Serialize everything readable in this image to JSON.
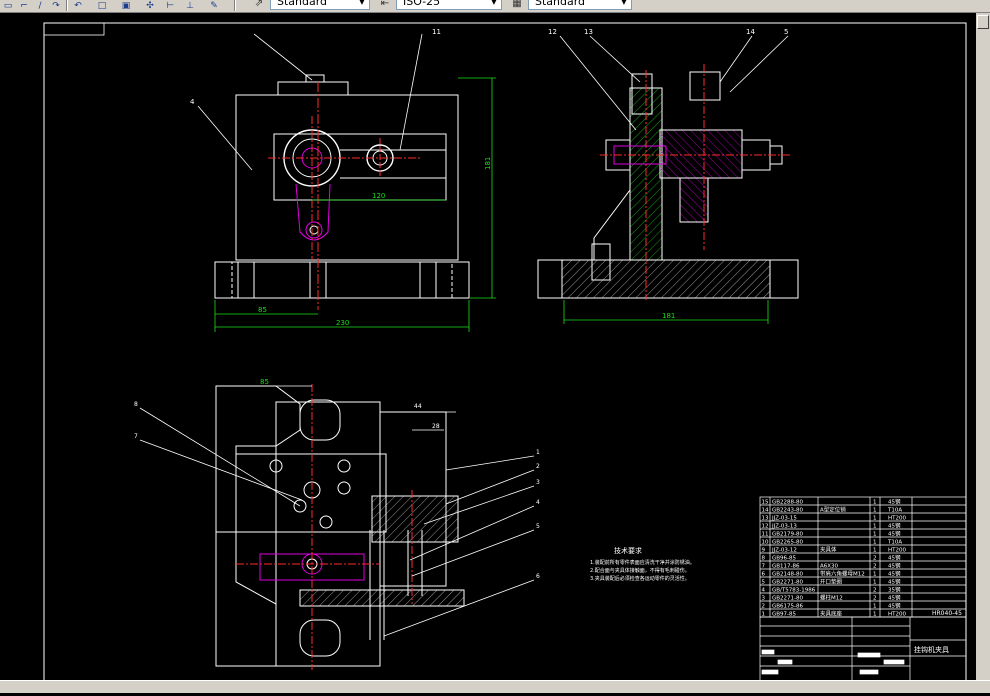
{
  "toolbar": {
    "text_style_value": "Standard",
    "dim_style_value": "ISO-25",
    "table_style_value": "Standard"
  },
  "drawing": {
    "balloons_top_view": [
      "11",
      "4"
    ],
    "balloons_side_view": [
      "12",
      "13",
      "14",
      "5"
    ],
    "balloons_plan_view": [
      "8",
      "7",
      "1",
      "2",
      "3",
      "4",
      "5",
      "6"
    ],
    "dim_top_width": "230",
    "dim_top_offset": "85",
    "dim_top_hole": "120",
    "dim_top_height": "181",
    "dim_side_width": "181",
    "dim_plan_85": "85",
    "dim_plan_a": "44",
    "dim_plan_b": "28",
    "tech_title": "技术要求",
    "tech_line_1": "1.装配前所有零件表面应清洗干净并涂防锈油。",
    "tech_line_2": "2.配合面与夹具体接触面，不得有毛刺碰伤。",
    "tech_line_3": "3.夹具装配后必须检查各运动零件的灵活性。"
  },
  "bom": [
    {
      "no": "15",
      "code": "GB2288-80",
      "name": "",
      "qty": "1",
      "mat": "45钢"
    },
    {
      "no": "14",
      "code": "GB2243-80",
      "name": "A型定位销",
      "qty": "1",
      "mat": "T10A"
    },
    {
      "no": "13",
      "code": "JJZ-03-15",
      "name": "",
      "qty": "1",
      "mat": "HT200"
    },
    {
      "no": "12",
      "code": "JJZ-03-13",
      "name": "",
      "qty": "1",
      "mat": "45钢"
    },
    {
      "no": "11",
      "code": "GB2179-80",
      "name": "",
      "qty": "1",
      "mat": "45钢"
    },
    {
      "no": "10",
      "code": "GB2265-80",
      "name": "",
      "qty": "1",
      "mat": "T10A"
    },
    {
      "no": "9",
      "code": "JJZ-03-12",
      "name": "夹具体",
      "qty": "1",
      "mat": "HT200"
    },
    {
      "no": "8",
      "code": "GB96-85",
      "name": "",
      "qty": "2",
      "mat": "45钢"
    },
    {
      "no": "7",
      "code": "GB117-86",
      "name": "A6X30",
      "qty": "2",
      "mat": "45钢"
    },
    {
      "no": "6",
      "code": "GB2148-80",
      "name": "带肩六角螺母M12",
      "qty": "1",
      "mat": "45钢"
    },
    {
      "no": "5",
      "code": "GB2271-80",
      "name": "开口垫圈",
      "qty": "1",
      "mat": "45钢"
    },
    {
      "no": "4",
      "code": "GB/T5783-1986",
      "name": "",
      "qty": "2",
      "mat": "35钢"
    },
    {
      "no": "3",
      "code": "GB2271-80",
      "name": "螺柱M12",
      "qty": "2",
      "mat": "45钢"
    },
    {
      "no": "2",
      "code": "GB6175-86",
      "name": "",
      "qty": "1",
      "mat": "45钢"
    },
    {
      "no": "1",
      "code": "GB97-85",
      "name": "夹具底座",
      "qty": "1",
      "mat": "HT200"
    }
  ],
  "title_block": {
    "drawing_number": "HR040-45",
    "part_name": "挂钩机夹具"
  },
  "colors": {
    "outline": "#ffffff",
    "centerline": "#ff2a2a",
    "dimension": "#18e018",
    "hatch_green": "#18e018",
    "magenta": "#e000e0",
    "balloon": "#ffffff"
  }
}
